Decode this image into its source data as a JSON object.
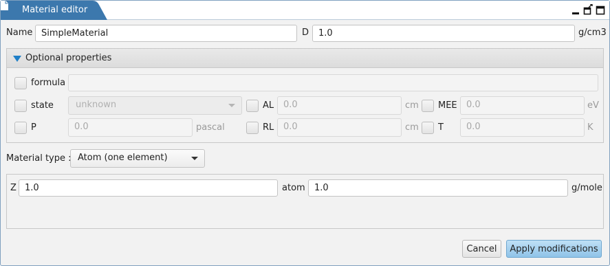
{
  "window": {
    "title": "Material editor",
    "accent": "#3c78ad",
    "controls": [
      "minimize-icon",
      "detach-icon",
      "maximize-icon"
    ]
  },
  "basic": {
    "name_label": "Name",
    "name_value": "SimpleMaterial",
    "density_label": "D",
    "density_value": "1.0",
    "density_unit": "g/cm3"
  },
  "optional": {
    "header": "Optional properties",
    "formula_label": "formula",
    "formula_value": "",
    "state_label": "state",
    "state_value": "unknown",
    "al_label": "AL",
    "al_value": "0.0",
    "al_unit": "cm",
    "mee_label": "MEE",
    "mee_value": "0.0",
    "mee_unit": "eV",
    "p_label": "P",
    "p_value": "0.0",
    "p_unit": "pascal",
    "rl_label": "RL",
    "rl_value": "0.0",
    "rl_unit": "cm",
    "t_label": "T",
    "t_value": "0.0",
    "t_unit": "K"
  },
  "material_type": {
    "label": "Material type :",
    "value": "Atom (one element)"
  },
  "atom": {
    "z_label": "Z",
    "z_value": "1.0",
    "atom_label": "atom",
    "atom_value": "1.0",
    "atom_unit": "g/mole"
  },
  "buttons": {
    "cancel": "Cancel",
    "apply": "Apply modifications"
  }
}
